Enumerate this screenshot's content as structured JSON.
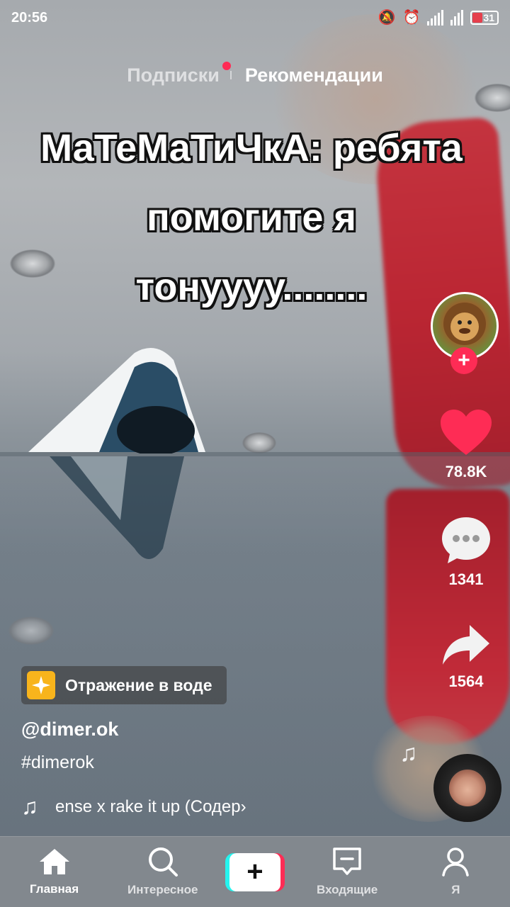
{
  "status_bar": {
    "time": "20:56",
    "battery": "31",
    "icons": [
      "mute-icon",
      "alarm-icon",
      "signal-icon",
      "signal-icon",
      "battery-icon"
    ]
  },
  "top_tabs": {
    "following": "Подписки",
    "recommended": "Рекомендации"
  },
  "caption": {
    "line1": "МаТеМаТиЧкА: ребята",
    "line2": "помогите я",
    "line3": "тонуууу........"
  },
  "actions": {
    "likes": "78.8K",
    "comments": "1341",
    "shares": "1564",
    "follow_plus": "+"
  },
  "effect": {
    "label": "Отражение в воде",
    "icon": "sparkle-icon"
  },
  "video_info": {
    "username": "@dimer.ok",
    "hashtag": "#dimerok",
    "music": "ense x rake it up (Содер›"
  },
  "bottom_nav": {
    "home": "Главная",
    "discover": "Интересное",
    "create": "+",
    "inbox": "Входящие",
    "profile": "Я"
  },
  "colors": {
    "accent": "#fe2c55",
    "cyan": "#25f4ee",
    "effect_icon_bg": "#f8b41c"
  }
}
